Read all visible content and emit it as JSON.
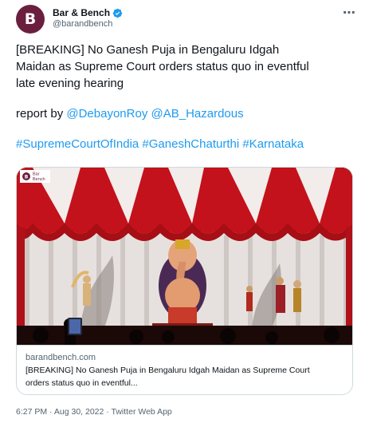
{
  "author": {
    "display_name": "Bar & Bench",
    "handle": "@barandbench",
    "avatar_letter": "B",
    "avatar_color": "#6b1f3e",
    "verified": true
  },
  "more_icon": "⋯",
  "tweet": {
    "headline_lines": [
      "[BREAKING] No Ganesh Puja in Bengaluru Idgah",
      "Maidan as Supreme Court orders status quo in eventful",
      "late evening hearing"
    ],
    "report_prefix": "report by ",
    "mentions": [
      "@DebayonRoy",
      "@AB_Hazardous"
    ],
    "hashtags": [
      "#SupremeCourtOfIndia",
      "#GaneshChaturthi",
      "#Karnataka"
    ]
  },
  "card": {
    "image_logo_text": [
      "Bar",
      "Bench"
    ],
    "domain": "barandbench.com",
    "title_lines": [
      "[BREAKING] No Ganesh Puja in Bengaluru Idgah Maidan as Supreme Court",
      "orders status quo in eventful..."
    ]
  },
  "footer": {
    "time": "6:27 PM",
    "date": "Aug 30, 2022",
    "source": "Twitter Web App",
    "separator": " · "
  },
  "colors": {
    "link": "#1d9bf0",
    "text": "#0f1419",
    "secondary": "#536471",
    "border": "#cfd9de"
  }
}
